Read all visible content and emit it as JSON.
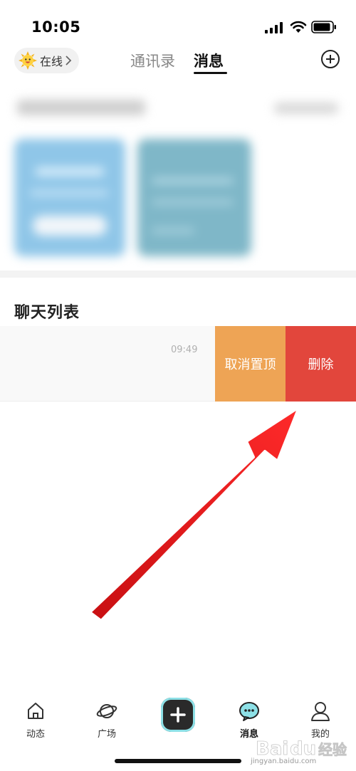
{
  "status_bar": {
    "time": "10:05"
  },
  "header": {
    "online_label": "在线",
    "tabs": [
      {
        "label": "通讯录",
        "active": false
      },
      {
        "label": "消息",
        "active": true
      }
    ]
  },
  "chat": {
    "section_title": "聊天列表",
    "rows": [
      {
        "time": "09:49",
        "actions": {
          "unpin_label": "取消置顶",
          "delete_label": "删除"
        }
      }
    ]
  },
  "bottom_nav": {
    "items": [
      {
        "label": "动态",
        "icon": "home-icon",
        "active": false
      },
      {
        "label": "广场",
        "icon": "planet-icon",
        "active": false
      },
      {
        "label": "",
        "icon": "plus-icon",
        "active": false
      },
      {
        "label": "消息",
        "icon": "chat-bubble-icon",
        "active": true
      },
      {
        "label": "我的",
        "icon": "person-icon",
        "active": false
      }
    ]
  },
  "watermark": {
    "text": "jingyan.baidu.com"
  },
  "colors": {
    "unpin_bg": "#eea455",
    "delete_bg": "#e2463c",
    "arrow": "#e8161b",
    "active_tab": "#111111"
  }
}
